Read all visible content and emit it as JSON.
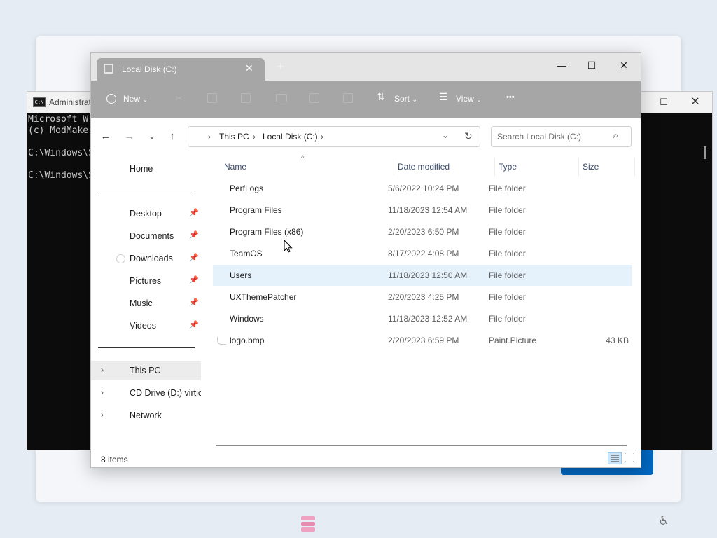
{
  "cmd": {
    "title": "Administrat",
    "lines": [
      "Microsoft W",
      "(c) ModMaker",
      "",
      "C:\\Windows\\S",
      "",
      "C:\\Windows\\S"
    ]
  },
  "explorer": {
    "tab_title": "Local Disk (C:)",
    "new_tab": "+",
    "window_buttons": {
      "minimize": "—",
      "maximize": "☐",
      "close": "✕"
    },
    "toolbar": {
      "new_label": "New",
      "sort_label": "Sort",
      "view_label": "View",
      "more_label": "•••"
    },
    "breadcrumb": [
      "This PC",
      "Local Disk (C:)"
    ],
    "search_placeholder": "Search Local Disk (C:)",
    "sidebar": {
      "home": "Home",
      "pinned": [
        {
          "label": "Desktop",
          "pinned": true
        },
        {
          "label": "Documents",
          "pinned": true
        },
        {
          "label": "Downloads",
          "pinned": true
        },
        {
          "label": "Pictures",
          "pinned": true
        },
        {
          "label": "Music",
          "pinned": true
        },
        {
          "label": "Videos",
          "pinned": true
        }
      ],
      "drives": [
        {
          "label": "This PC",
          "selected": true
        },
        {
          "label": "CD Drive (D:) virtio-"
        },
        {
          "label": "Network"
        }
      ]
    },
    "columns": {
      "name": "Name",
      "date": "Date modified",
      "type": "Type",
      "size": "Size"
    },
    "files": [
      {
        "name": "PerfLogs",
        "date": "5/6/2022 10:24 PM",
        "type": "File folder",
        "size": ""
      },
      {
        "name": "Program Files",
        "date": "11/18/2023 12:54 AM",
        "type": "File folder",
        "size": ""
      },
      {
        "name": "Program Files (x86)",
        "date": "2/20/2023 6:50 PM",
        "type": "File folder",
        "size": ""
      },
      {
        "name": "TeamOS",
        "date": "8/17/2022 4:08 PM",
        "type": "File folder",
        "size": ""
      },
      {
        "name": "Users",
        "date": "11/18/2023 12:50 AM",
        "type": "File folder",
        "size": "",
        "selected": true
      },
      {
        "name": "UXThemePatcher",
        "date": "2/20/2023 4:25 PM",
        "type": "File folder",
        "size": ""
      },
      {
        "name": "Windows",
        "date": "11/18/2023 12:52 AM",
        "type": "File folder",
        "size": ""
      },
      {
        "name": "logo.bmp",
        "date": "2/20/2023 6:59 PM",
        "type": "Paint.Picture",
        "size": "43 KB"
      }
    ],
    "status": "8 items"
  },
  "colors": {
    "accent": "#0067c0",
    "selection": "#e5f1fb",
    "toolbar_bg": "#a6a6a6"
  }
}
